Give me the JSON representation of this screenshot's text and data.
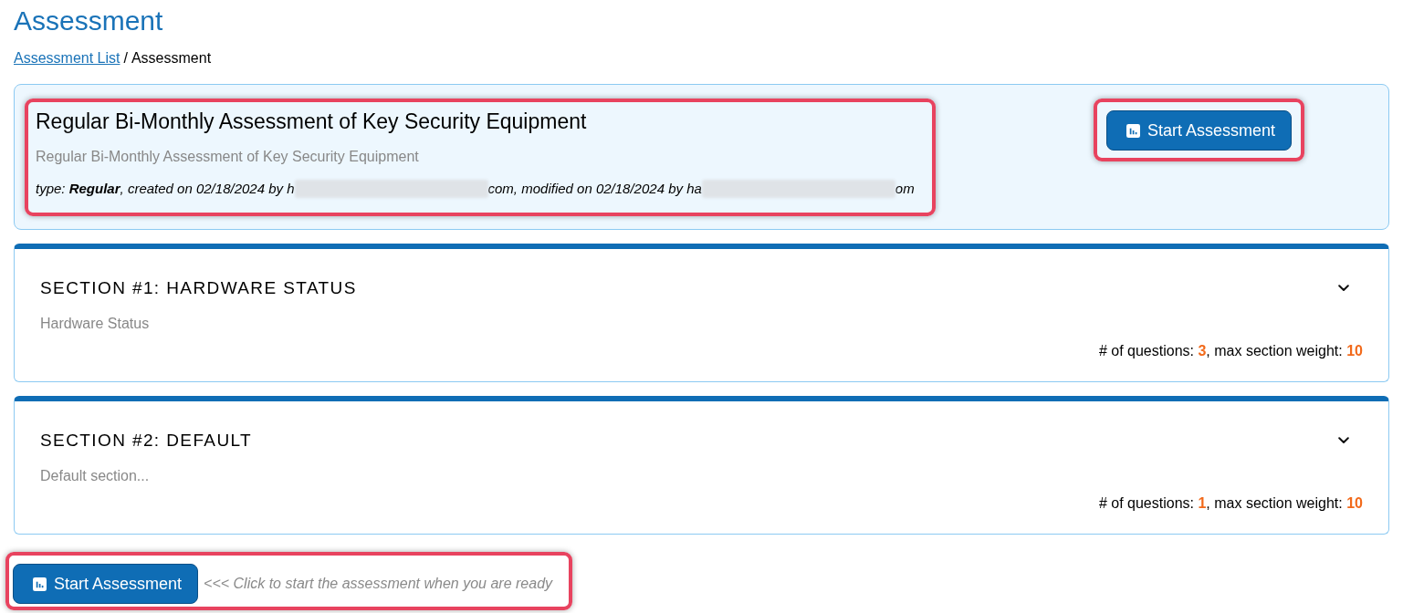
{
  "page": {
    "title": "Assessment"
  },
  "breadcrumb": {
    "items": [
      {
        "label": "Assessment List",
        "kind": "link"
      },
      {
        "label": "Assessment",
        "kind": "current"
      }
    ],
    "separator": "/"
  },
  "assessment": {
    "highlighted": true,
    "title": "Regular Bi-Monthly Assessment of Key Security Equipment",
    "description": "Regular Bi-Monthly Assessment of Key Security Equipment",
    "meta": [
      {
        "kind": "text",
        "text": "type: **Regular**, created on 02/18/2024 by h"
      },
      {
        "kind": "redacted"
      },
      {
        "kind": "text",
        "text": "com, modified on 02/18/2024 by ha"
      },
      {
        "kind": "redacted"
      },
      {
        "kind": "text",
        "text": "om"
      }
    ],
    "start_button": {
      "label": "Start Assessment",
      "highlighted": true
    }
  },
  "sections": [
    {
      "title": "SECTION #1: HARDWARE STATUS",
      "description": "Hardware Status",
      "stats": "# of questions: **3**, max section weight: **10**"
    },
    {
      "title": "SECTION #2: DEFAULT",
      "description": "Default section...",
      "stats": "# of questions: **1**, max section weight: **10**"
    }
  ],
  "footer": {
    "highlighted": true,
    "start_button": {
      "label": "Start Assessment"
    },
    "hint": "<<< Click to start the assessment when you are ready"
  }
}
